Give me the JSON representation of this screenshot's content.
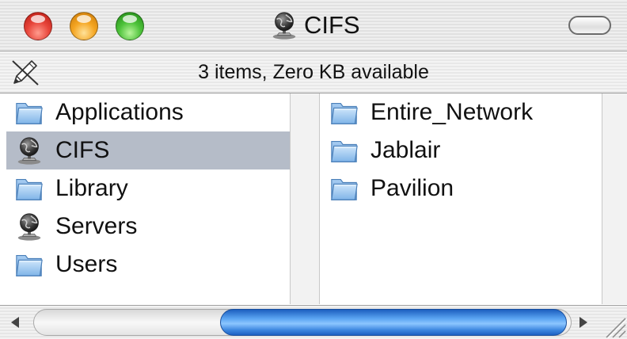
{
  "window": {
    "title": "CIFS",
    "title_icon": "network-globe-icon",
    "status": "3 items, Zero KB available"
  },
  "columns": [
    {
      "items": [
        {
          "label": "Applications",
          "icon": "folder-icon",
          "selected": false
        },
        {
          "label": "CIFS",
          "icon": "network-globe-icon",
          "selected": true
        },
        {
          "label": "Library",
          "icon": "folder-icon",
          "selected": false
        },
        {
          "label": "Servers",
          "icon": "network-globe-icon",
          "selected": false
        },
        {
          "label": "Users",
          "icon": "folder-icon",
          "selected": false
        }
      ]
    },
    {
      "items": [
        {
          "label": "Entire_Network",
          "icon": "folder-icon"
        },
        {
          "label": "Jablair",
          "icon": "folder-icon"
        },
        {
          "label": "Pavilion",
          "icon": "folder-icon"
        }
      ]
    }
  ],
  "colors": {
    "selection": "#b5bcc8",
    "close_button": "#e8463b",
    "minimize_button": "#f5a623",
    "zoom_button": "#4dc23a",
    "scroll_thumb": "#3d87e0"
  },
  "scroll": {
    "horizontal_thumb_position_fraction": 0.41,
    "horizontal_thumb_size_fraction": 0.64
  }
}
